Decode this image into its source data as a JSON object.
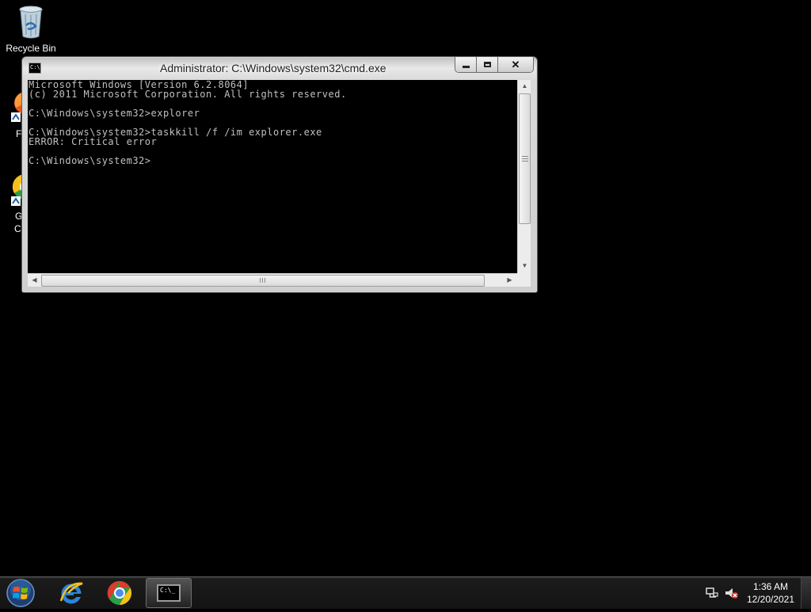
{
  "desktop": {
    "icons": [
      {
        "label": "Recycle Bin"
      },
      {
        "label": "F"
      },
      {
        "label": "G"
      },
      {
        "label": "C"
      }
    ]
  },
  "window": {
    "title": "Administrator: C:\\Windows\\system32\\cmd.exe",
    "icon_glyph": "C:\\",
    "console_lines": [
      "Microsoft Windows [Version 6.2.8064]",
      "(c) 2011 Microsoft Corporation. All rights reserved.",
      "",
      "C:\\Windows\\system32>explorer",
      "",
      "C:\\Windows\\system32>taskkill /f /im explorer.exe",
      "ERROR: Critical error",
      "",
      "C:\\Windows\\system32>"
    ],
    "close_glyph": "✕"
  },
  "taskbar": {
    "pinned": [
      {
        "name": "start-button",
        "icon": "windows-orb-icon"
      },
      {
        "name": "internet-explorer",
        "icon": "ie-icon"
      },
      {
        "name": "chrome",
        "icon": "chrome-icon"
      },
      {
        "name": "cmd",
        "icon": "cmd-icon",
        "glyph": "C:\\_"
      }
    ],
    "clock": {
      "time": "1:36 AM",
      "date": "12/20/2021"
    },
    "tray_icons": [
      "network-icon",
      "volume-muted-icon"
    ]
  },
  "colors": {
    "desktop_bg": "#000000",
    "console_text": "#c0c0c0",
    "taskbar_bg": "#141414"
  }
}
